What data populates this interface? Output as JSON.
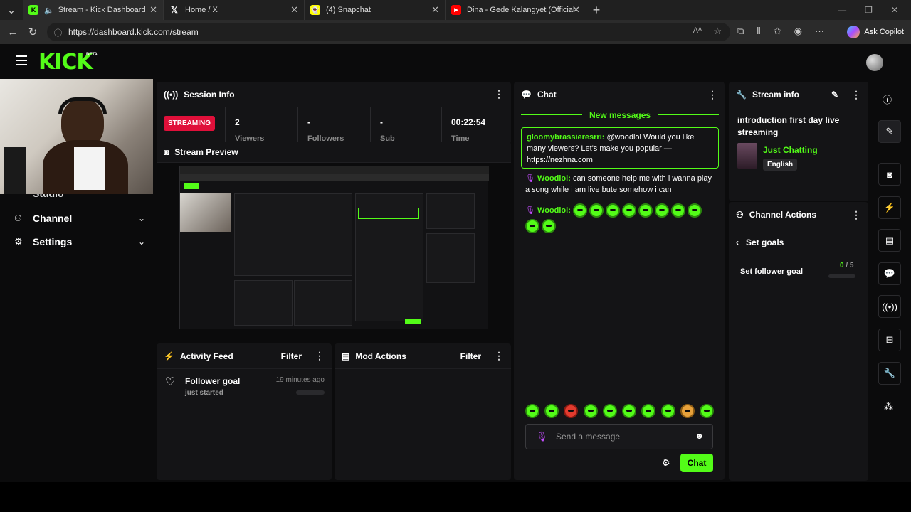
{
  "browser": {
    "tabs": [
      {
        "title": "Stream - Kick Dashboard",
        "favicon": "kick-icon"
      },
      {
        "title": "Home / X",
        "favicon": "x-icon"
      },
      {
        "title": "(4) Snapchat",
        "favicon": "snapchat-icon"
      },
      {
        "title": "Dina - Gede Kalangyet (Official Vi",
        "favicon": "youtube-icon"
      }
    ],
    "url": "https://dashboard.kick.com/stream",
    "copilot_label": "Ask Copilot"
  },
  "app": {
    "logo": "KICK",
    "logo_badge": "BETA",
    "accent": "#53fc18",
    "sidebar": {
      "partial_item": "Studio",
      "items": [
        {
          "label": "Channel",
          "icon": "channel-icon"
        },
        {
          "label": "Settings",
          "icon": "gear-icon"
        }
      ]
    },
    "session_info": {
      "title": "Session Info",
      "status": "STREAMING",
      "stats": [
        {
          "value": "2",
          "label": "Viewers"
        },
        {
          "value": "-",
          "label": "Followers"
        },
        {
          "value": "-",
          "label": "Sub Counts"
        },
        {
          "value": "00:22:54",
          "label": "Time Live"
        }
      ]
    },
    "stream_preview": {
      "title": "Stream Preview"
    },
    "activity_feed": {
      "title": "Activity Feed",
      "filter": "Filter",
      "items": [
        {
          "title": "Follower goal",
          "sub": "just started",
          "time": "19 minutes ago"
        }
      ]
    },
    "mod_actions": {
      "title": "Mod Actions",
      "filter": "Filter"
    },
    "chat": {
      "title": "Chat",
      "new_messages": "New messages",
      "messages": [
        {
          "user": "gloomybrassieresrri:",
          "text": "@woodlol Would you like many viewers? Let's make you popular — https://nezhna.com",
          "highlight": true
        },
        {
          "user": "Woodlol:",
          "text": "can someone help me with i wanna play a song while i am live bute somehow i can",
          "highlight": false
        },
        {
          "user": "Woodlol:",
          "text": "",
          "highlight": false
        }
      ],
      "input_placeholder": "Send a message",
      "send_button": "Chat"
    },
    "stream_info": {
      "title": "Stream info",
      "stream_title": "introduction first day live streaming",
      "category": "Just Chatting",
      "language": "English"
    },
    "channel_actions": {
      "title": "Channel Actions",
      "back_label": "Set goals",
      "goal_label": "Set follower goal",
      "goal_current": "0",
      "goal_total": "/ 5",
      "goal_progress": 0
    }
  }
}
